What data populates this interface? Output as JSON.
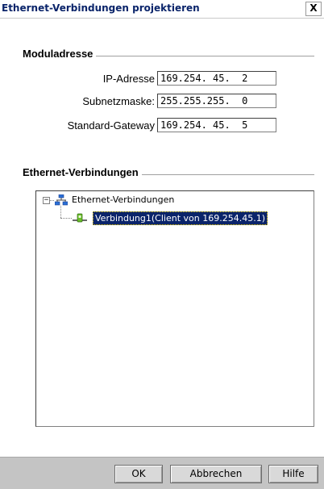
{
  "window": {
    "title": "Ethernet-Verbindungen projektieren",
    "close_label": "X"
  },
  "moduladresse": {
    "title": "Moduladresse",
    "fields": [
      {
        "label": "IP-Adresse",
        "value": "169.254. 45.  2"
      },
      {
        "label": "Subnetzmaske:",
        "value": "255.255.255.  0"
      },
      {
        "label": "Standard-Gateway",
        "value": "169.254. 45.  5"
      }
    ]
  },
  "verbindungen": {
    "title": "Ethernet-Verbindungen",
    "tree": {
      "root_label": "Ethernet-Verbindungen",
      "root_toggle": "−",
      "child_label": "Verbindung1(Client von  169.254.45.1)"
    }
  },
  "buttons": {
    "ok": "OK",
    "cancel": "Abbrechen",
    "help": "Hilfe"
  }
}
